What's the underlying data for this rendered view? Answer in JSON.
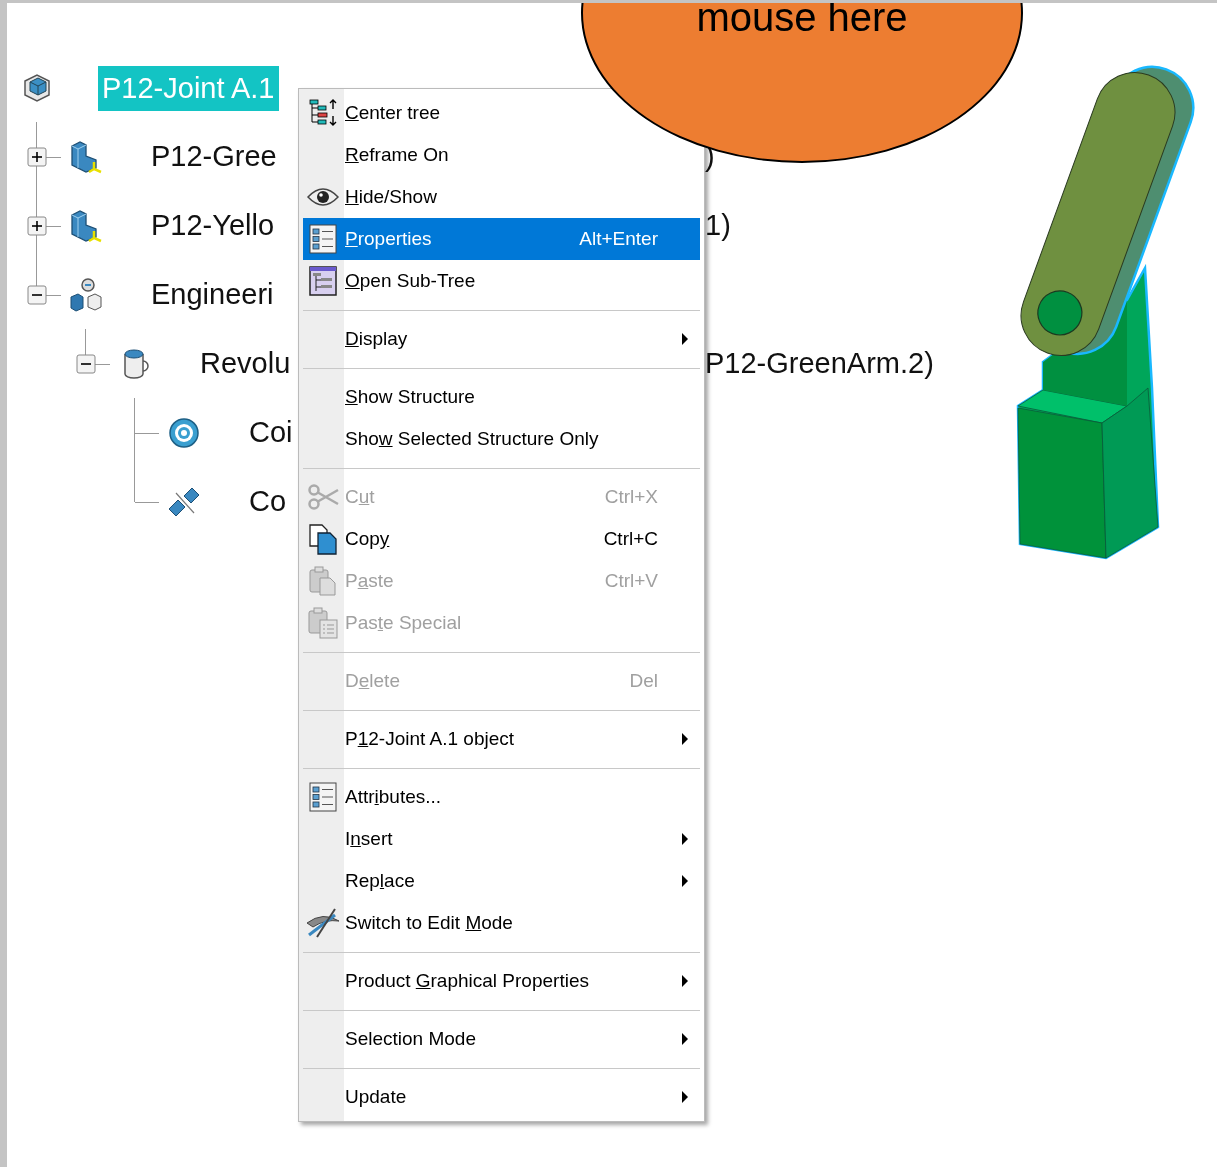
{
  "tree": {
    "label": "P12-Joint A.1",
    "selected": true,
    "children": [
      {
        "label": "P12-Gree",
        "tail": ")",
        "selected": false,
        "expanded": false
      },
      {
        "label": "P12-Yello",
        "tail": "1)",
        "selected": false,
        "expanded": false
      },
      {
        "label": "Engineeri",
        "selected": false,
        "expanded": true,
        "children": [
          {
            "label": "Revolu",
            "tail": "P12-GreenArm.2)",
            "selected": false,
            "expanded": true,
            "children": [
              {
                "label": "Coi",
                "selected": false
              },
              {
                "label": "Co",
                "selected": false
              }
            ]
          }
        ]
      }
    ]
  },
  "context_menu": {
    "items": [
      {
        "kind": "item",
        "key": "C",
        "post": "enter tree",
        "selected": false,
        "disabled": false,
        "submenu": false
      },
      {
        "kind": "item",
        "key": "R",
        "post": "eframe On",
        "selected": false,
        "disabled": false,
        "submenu": false
      },
      {
        "kind": "item",
        "key": "H",
        "post": "ide/Show",
        "selected": false,
        "disabled": false,
        "submenu": false
      },
      {
        "kind": "item",
        "key": "P",
        "post": "roperties",
        "shortcut": "Alt+Enter",
        "selected": true,
        "disabled": false,
        "submenu": false
      },
      {
        "kind": "item",
        "key": "O",
        "post": "pen Sub-Tree",
        "selected": false,
        "disabled": false,
        "submenu": false
      },
      {
        "kind": "separator"
      },
      {
        "kind": "item",
        "key": "D",
        "post": "isplay",
        "selected": false,
        "disabled": false,
        "submenu": true
      },
      {
        "kind": "separator"
      },
      {
        "kind": "item",
        "key": "S",
        "post": "how Structure",
        "selected": false,
        "disabled": false,
        "submenu": false
      },
      {
        "kind": "item",
        "pre": "Sho",
        "key": "w",
        "post": " Selected Structure Only",
        "selected": false,
        "disabled": false,
        "submenu": false
      },
      {
        "kind": "separator"
      },
      {
        "kind": "item",
        "pre": "C",
        "key": "u",
        "post": "t",
        "shortcut": "Ctrl+X",
        "selected": false,
        "disabled": true,
        "submenu": false
      },
      {
        "kind": "item",
        "pre": "Cop",
        "key": "y",
        "shortcut": "Ctrl+C",
        "selected": false,
        "disabled": false,
        "submenu": false
      },
      {
        "kind": "item",
        "pre": "P",
        "key": "a",
        "post": "ste",
        "shortcut": "Ctrl+V",
        "selected": false,
        "disabled": true,
        "submenu": false
      },
      {
        "kind": "item",
        "pre": "Pas",
        "key": "t",
        "post": "e Special",
        "selected": false,
        "disabled": true,
        "submenu": false
      },
      {
        "kind": "separator"
      },
      {
        "kind": "item",
        "pre": "D",
        "key": "e",
        "post": "lete",
        "shortcut": "Del",
        "selected": false,
        "disabled": true,
        "submenu": false
      },
      {
        "kind": "separator"
      },
      {
        "kind": "item",
        "pre": "P",
        "key": "1",
        "post": "2-Joint A.1 object",
        "selected": false,
        "disabled": false,
        "submenu": true
      },
      {
        "kind": "separator"
      },
      {
        "kind": "item",
        "pre": "Attr",
        "key": "i",
        "post": "butes...",
        "selected": false,
        "disabled": false,
        "submenu": false
      },
      {
        "kind": "item",
        "pre": "I",
        "key": "n",
        "post": "sert",
        "selected": false,
        "disabled": false,
        "submenu": true
      },
      {
        "kind": "item",
        "pre": "Rep",
        "key": "l",
        "post": "ace",
        "selected": false,
        "disabled": false,
        "submenu": true
      },
      {
        "kind": "item",
        "pre": "Switch to Edit ",
        "key": "M",
        "post": "ode",
        "selected": false,
        "disabled": false,
        "submenu": false
      },
      {
        "kind": "separator"
      },
      {
        "kind": "item",
        "pre": "Product ",
        "key": "G",
        "post": "raphical Properties",
        "selected": false,
        "disabled": false,
        "submenu": true
      },
      {
        "kind": "separator"
      },
      {
        "kind": "item",
        "pre": "Selection Mode",
        "selected": false,
        "disabled": false,
        "submenu": true
      },
      {
        "kind": "separator"
      },
      {
        "kind": "item",
        "pre": "Update",
        "selected": false,
        "disabled": false,
        "submenu": true
      }
    ]
  },
  "callout": {
    "text": "mouse here"
  }
}
